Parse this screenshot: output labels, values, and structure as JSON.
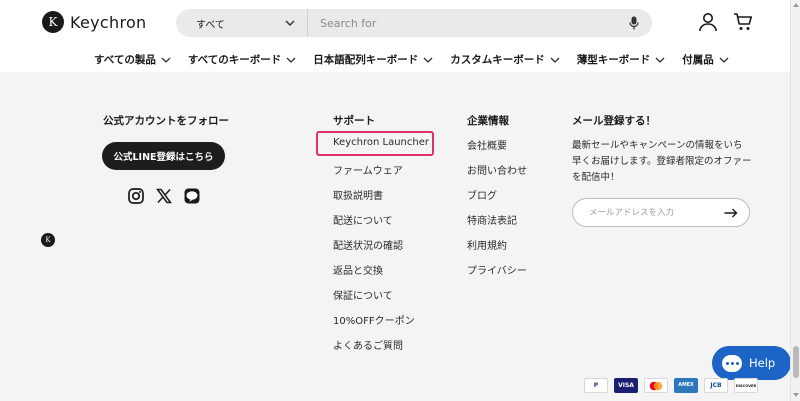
{
  "header": {
    "logo_text": "Keychron",
    "search_category": "すべて",
    "search_placeholder": "Search for"
  },
  "nav": {
    "items": [
      "すべての製品",
      "すべてのキーボード",
      "日本語配列キーボード",
      "カスタムキーボード",
      "薄型キーボード",
      "付属品"
    ]
  },
  "footer": {
    "follow": {
      "title": "公式アカウントをフォロー",
      "line_button": "公式LINE登録はこちら"
    },
    "support": {
      "title": "サポート",
      "links": [
        "Keychron Launcher",
        "ファームウェア",
        "取扱説明書",
        "配送について",
        "配送状況の確認",
        "返品と交換",
        "保証について",
        "10%OFFクーポン",
        "よくあるご質問"
      ]
    },
    "company": {
      "title": "企業情報",
      "links": [
        "会社概要",
        "お問い合わせ",
        "ブログ",
        "特商法表記",
        "利用規約",
        "プライバシー"
      ]
    },
    "newsletter": {
      "title": "メール登録する！",
      "text": "最新セールやキャンペーンの情報をいち早くお届けします。登録者限定のオファーを配信中！",
      "email_placeholder": "メールアドレスを入力"
    }
  },
  "help": {
    "label": "Help"
  },
  "payments": [
    "P",
    "VISA",
    "MC",
    "AMEX",
    "JCB",
    "DISCOVER"
  ],
  "colors": {
    "highlight": "#e0306e",
    "help_button": "#1d64c7",
    "dark_button": "#1d1d1d",
    "page_background": "#f4f4f4"
  }
}
